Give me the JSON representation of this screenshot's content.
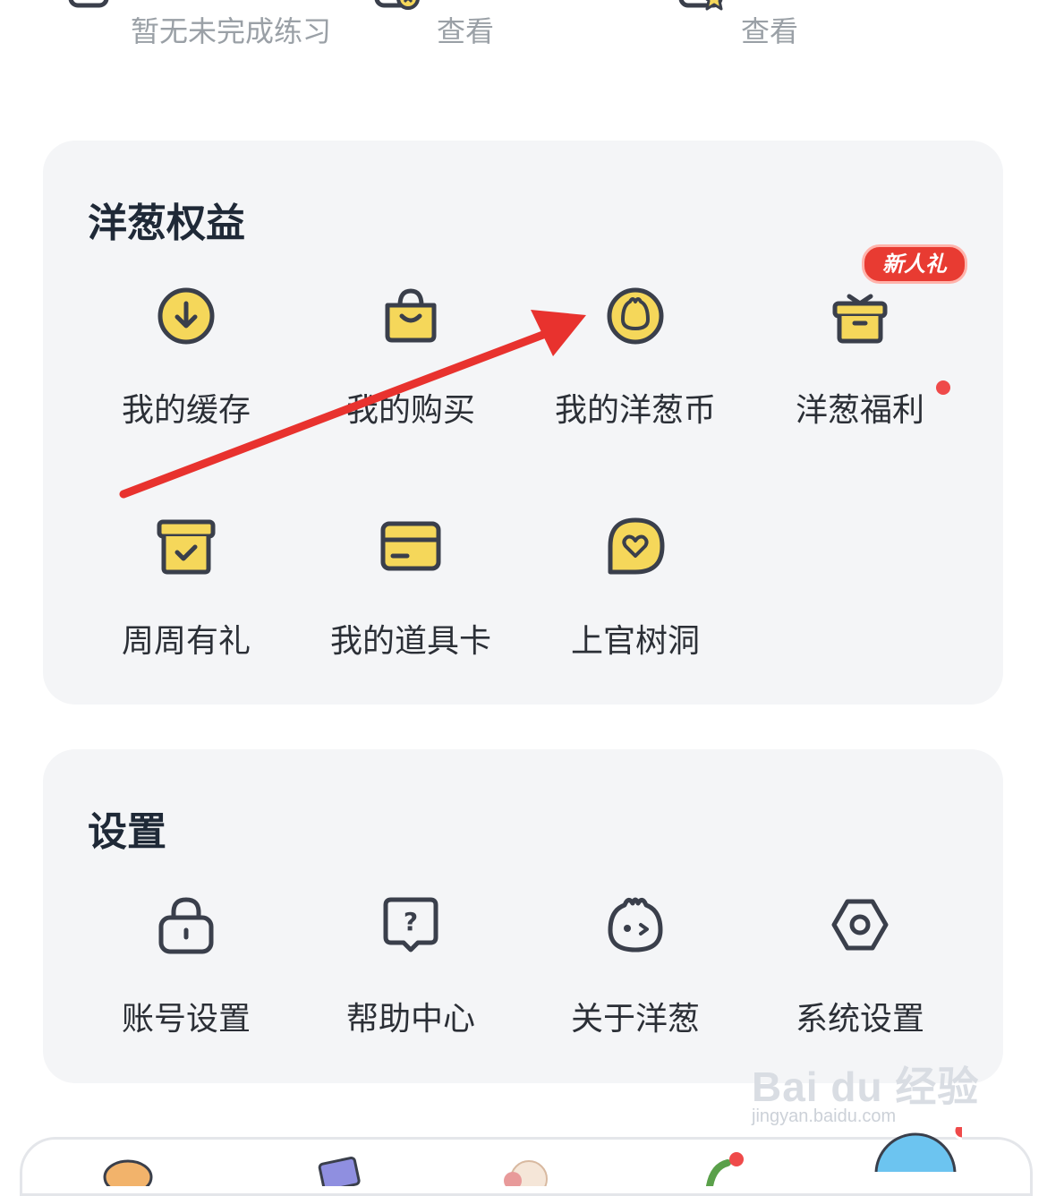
{
  "top_row": {
    "items": [
      {
        "icon": "edit-icon",
        "text": "暂无未完成练习"
      },
      {
        "icon": "wrong-book-icon",
        "text": "查看"
      },
      {
        "icon": "favorite-book-icon",
        "text": "查看"
      }
    ]
  },
  "benefits": {
    "title": "洋葱权益",
    "items": [
      {
        "icon": "download-circle-icon",
        "label": "我的缓存"
      },
      {
        "icon": "shopping-bag-icon",
        "label": "我的购买"
      },
      {
        "icon": "onion-coin-icon",
        "label": "我的洋葱币"
      },
      {
        "icon": "gift-icon",
        "label": "洋葱福利",
        "badge": "新人礼",
        "dot": true
      },
      {
        "icon": "archive-box-icon",
        "label": "周周有礼"
      },
      {
        "icon": "card-icon",
        "label": "我的道具卡"
      },
      {
        "icon": "heart-chat-icon",
        "label": "上官树洞"
      }
    ]
  },
  "settings": {
    "title": "设置",
    "items": [
      {
        "icon": "lock-icon",
        "label": "账号设置"
      },
      {
        "icon": "help-chat-icon",
        "label": "帮助中心"
      },
      {
        "icon": "onion-face-icon",
        "label": "关于洋葱"
      },
      {
        "icon": "hex-gear-icon",
        "label": "系统设置"
      }
    ]
  },
  "watermark": {
    "main": "Bai du 经验",
    "sub": "jingyan.baidu.com"
  },
  "tabbar": {
    "tabs": [
      "tab-1-icon",
      "tab-2-icon",
      "tab-3-icon",
      "tab-4-icon",
      "tab-5-icon"
    ]
  },
  "colors": {
    "accent": "#f5d75a",
    "stroke": "#3a3f4b",
    "arrow": "#e8322e",
    "badge": "#e83b32",
    "card": "#f4f5f7"
  }
}
